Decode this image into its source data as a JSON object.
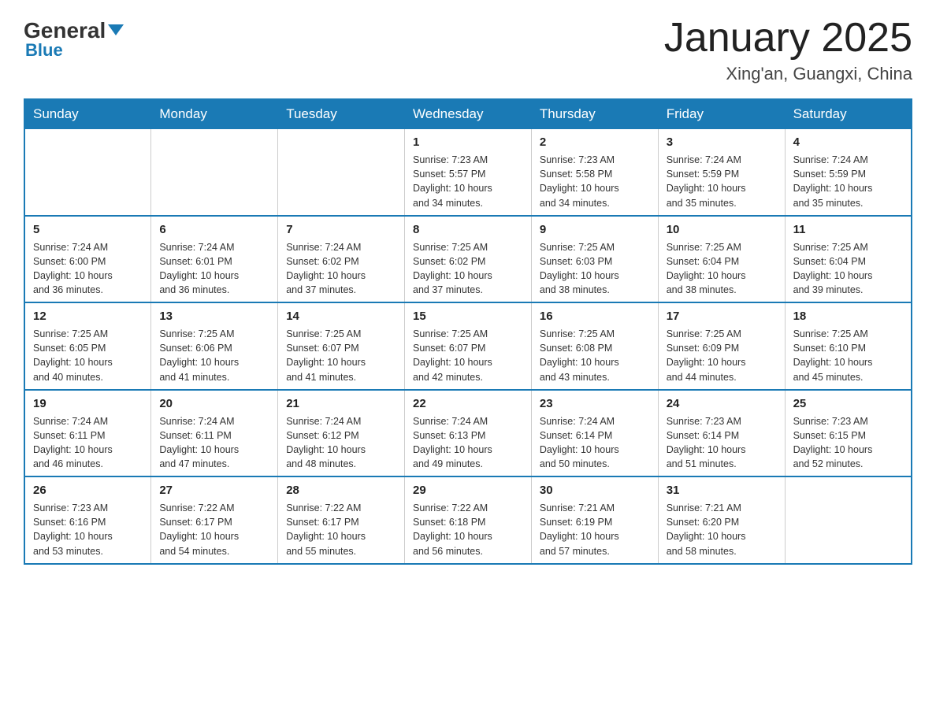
{
  "header": {
    "logo": {
      "general": "General",
      "blue": "Blue"
    },
    "title": "January 2025",
    "location": "Xing'an, Guangxi, China"
  },
  "calendar": {
    "days_of_week": [
      "Sunday",
      "Monday",
      "Tuesday",
      "Wednesday",
      "Thursday",
      "Friday",
      "Saturday"
    ],
    "weeks": [
      [
        {
          "day": "",
          "info": ""
        },
        {
          "day": "",
          "info": ""
        },
        {
          "day": "",
          "info": ""
        },
        {
          "day": "1",
          "info": "Sunrise: 7:23 AM\nSunset: 5:57 PM\nDaylight: 10 hours\nand 34 minutes."
        },
        {
          "day": "2",
          "info": "Sunrise: 7:23 AM\nSunset: 5:58 PM\nDaylight: 10 hours\nand 34 minutes."
        },
        {
          "day": "3",
          "info": "Sunrise: 7:24 AM\nSunset: 5:59 PM\nDaylight: 10 hours\nand 35 minutes."
        },
        {
          "day": "4",
          "info": "Sunrise: 7:24 AM\nSunset: 5:59 PM\nDaylight: 10 hours\nand 35 minutes."
        }
      ],
      [
        {
          "day": "5",
          "info": "Sunrise: 7:24 AM\nSunset: 6:00 PM\nDaylight: 10 hours\nand 36 minutes."
        },
        {
          "day": "6",
          "info": "Sunrise: 7:24 AM\nSunset: 6:01 PM\nDaylight: 10 hours\nand 36 minutes."
        },
        {
          "day": "7",
          "info": "Sunrise: 7:24 AM\nSunset: 6:02 PM\nDaylight: 10 hours\nand 37 minutes."
        },
        {
          "day": "8",
          "info": "Sunrise: 7:25 AM\nSunset: 6:02 PM\nDaylight: 10 hours\nand 37 minutes."
        },
        {
          "day": "9",
          "info": "Sunrise: 7:25 AM\nSunset: 6:03 PM\nDaylight: 10 hours\nand 38 minutes."
        },
        {
          "day": "10",
          "info": "Sunrise: 7:25 AM\nSunset: 6:04 PM\nDaylight: 10 hours\nand 38 minutes."
        },
        {
          "day": "11",
          "info": "Sunrise: 7:25 AM\nSunset: 6:04 PM\nDaylight: 10 hours\nand 39 minutes."
        }
      ],
      [
        {
          "day": "12",
          "info": "Sunrise: 7:25 AM\nSunset: 6:05 PM\nDaylight: 10 hours\nand 40 minutes."
        },
        {
          "day": "13",
          "info": "Sunrise: 7:25 AM\nSunset: 6:06 PM\nDaylight: 10 hours\nand 41 minutes."
        },
        {
          "day": "14",
          "info": "Sunrise: 7:25 AM\nSunset: 6:07 PM\nDaylight: 10 hours\nand 41 minutes."
        },
        {
          "day": "15",
          "info": "Sunrise: 7:25 AM\nSunset: 6:07 PM\nDaylight: 10 hours\nand 42 minutes."
        },
        {
          "day": "16",
          "info": "Sunrise: 7:25 AM\nSunset: 6:08 PM\nDaylight: 10 hours\nand 43 minutes."
        },
        {
          "day": "17",
          "info": "Sunrise: 7:25 AM\nSunset: 6:09 PM\nDaylight: 10 hours\nand 44 minutes."
        },
        {
          "day": "18",
          "info": "Sunrise: 7:25 AM\nSunset: 6:10 PM\nDaylight: 10 hours\nand 45 minutes."
        }
      ],
      [
        {
          "day": "19",
          "info": "Sunrise: 7:24 AM\nSunset: 6:11 PM\nDaylight: 10 hours\nand 46 minutes."
        },
        {
          "day": "20",
          "info": "Sunrise: 7:24 AM\nSunset: 6:11 PM\nDaylight: 10 hours\nand 47 minutes."
        },
        {
          "day": "21",
          "info": "Sunrise: 7:24 AM\nSunset: 6:12 PM\nDaylight: 10 hours\nand 48 minutes."
        },
        {
          "day": "22",
          "info": "Sunrise: 7:24 AM\nSunset: 6:13 PM\nDaylight: 10 hours\nand 49 minutes."
        },
        {
          "day": "23",
          "info": "Sunrise: 7:24 AM\nSunset: 6:14 PM\nDaylight: 10 hours\nand 50 minutes."
        },
        {
          "day": "24",
          "info": "Sunrise: 7:23 AM\nSunset: 6:14 PM\nDaylight: 10 hours\nand 51 minutes."
        },
        {
          "day": "25",
          "info": "Sunrise: 7:23 AM\nSunset: 6:15 PM\nDaylight: 10 hours\nand 52 minutes."
        }
      ],
      [
        {
          "day": "26",
          "info": "Sunrise: 7:23 AM\nSunset: 6:16 PM\nDaylight: 10 hours\nand 53 minutes."
        },
        {
          "day": "27",
          "info": "Sunrise: 7:22 AM\nSunset: 6:17 PM\nDaylight: 10 hours\nand 54 minutes."
        },
        {
          "day": "28",
          "info": "Sunrise: 7:22 AM\nSunset: 6:17 PM\nDaylight: 10 hours\nand 55 minutes."
        },
        {
          "day": "29",
          "info": "Sunrise: 7:22 AM\nSunset: 6:18 PM\nDaylight: 10 hours\nand 56 minutes."
        },
        {
          "day": "30",
          "info": "Sunrise: 7:21 AM\nSunset: 6:19 PM\nDaylight: 10 hours\nand 57 minutes."
        },
        {
          "day": "31",
          "info": "Sunrise: 7:21 AM\nSunset: 6:20 PM\nDaylight: 10 hours\nand 58 minutes."
        },
        {
          "day": "",
          "info": ""
        }
      ]
    ]
  }
}
